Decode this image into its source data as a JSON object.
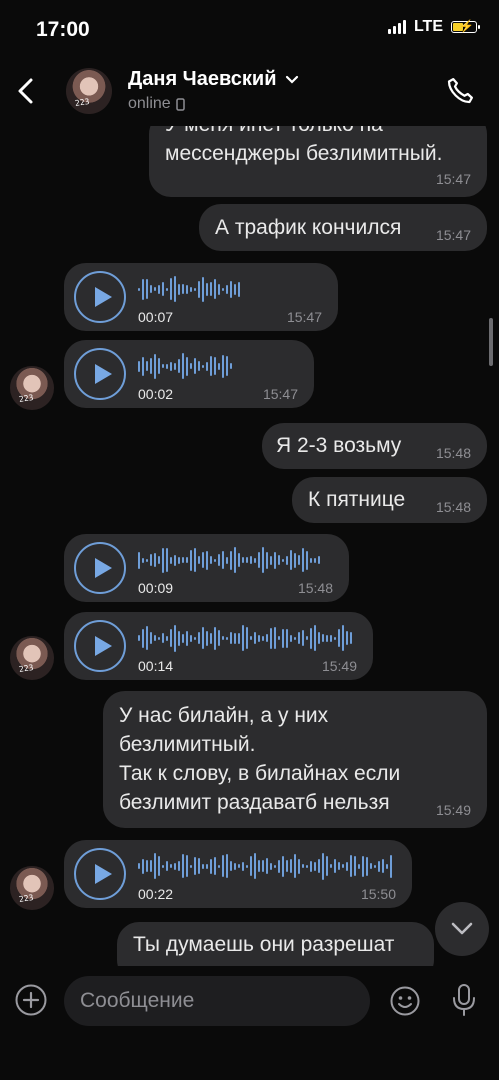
{
  "status_bar": {
    "time": "17:00",
    "network": "LTE"
  },
  "header": {
    "name": "Даня Чаевский",
    "status": "online"
  },
  "input": {
    "placeholder": "Сообщение"
  },
  "messages": [
    {
      "text": "У меня инет только на\nмессенджеры безлимитный.",
      "time": "15:47"
    },
    {
      "text": "А трафик кончился",
      "time": "15:47"
    },
    {
      "duration": "00:07",
      "time": "15:47"
    },
    {
      "duration": "00:02",
      "time": "15:47"
    },
    {
      "text": "Я 2-3 возьму",
      "time": "15:48"
    },
    {
      "text": "К пятнице",
      "time": "15:48"
    },
    {
      "duration": "00:09",
      "time": "15:48"
    },
    {
      "duration": "00:14",
      "time": "15:49"
    },
    {
      "text": "У нас билайн, а у них\nбезлимитный.\nТак к слову, в билайнах если\nбезлимит раздаватб нельзя",
      "time": "15:49"
    },
    {
      "duration": "00:22",
      "time": "15:50"
    },
    {
      "text": "Ты думаешь они разрешат",
      "time": ""
    }
  ],
  "colors": {
    "accent": "#6f9ed8",
    "bubble": "#2c2c2e",
    "background": "#0a0a0a",
    "battery": "#f6d02a"
  },
  "icons": [
    "back-icon",
    "chevron-down-icon",
    "phone-icon",
    "mobile-device-icon",
    "play-icon",
    "chevron-down-icon",
    "plus-icon",
    "smile-icon",
    "microphone-icon"
  ]
}
